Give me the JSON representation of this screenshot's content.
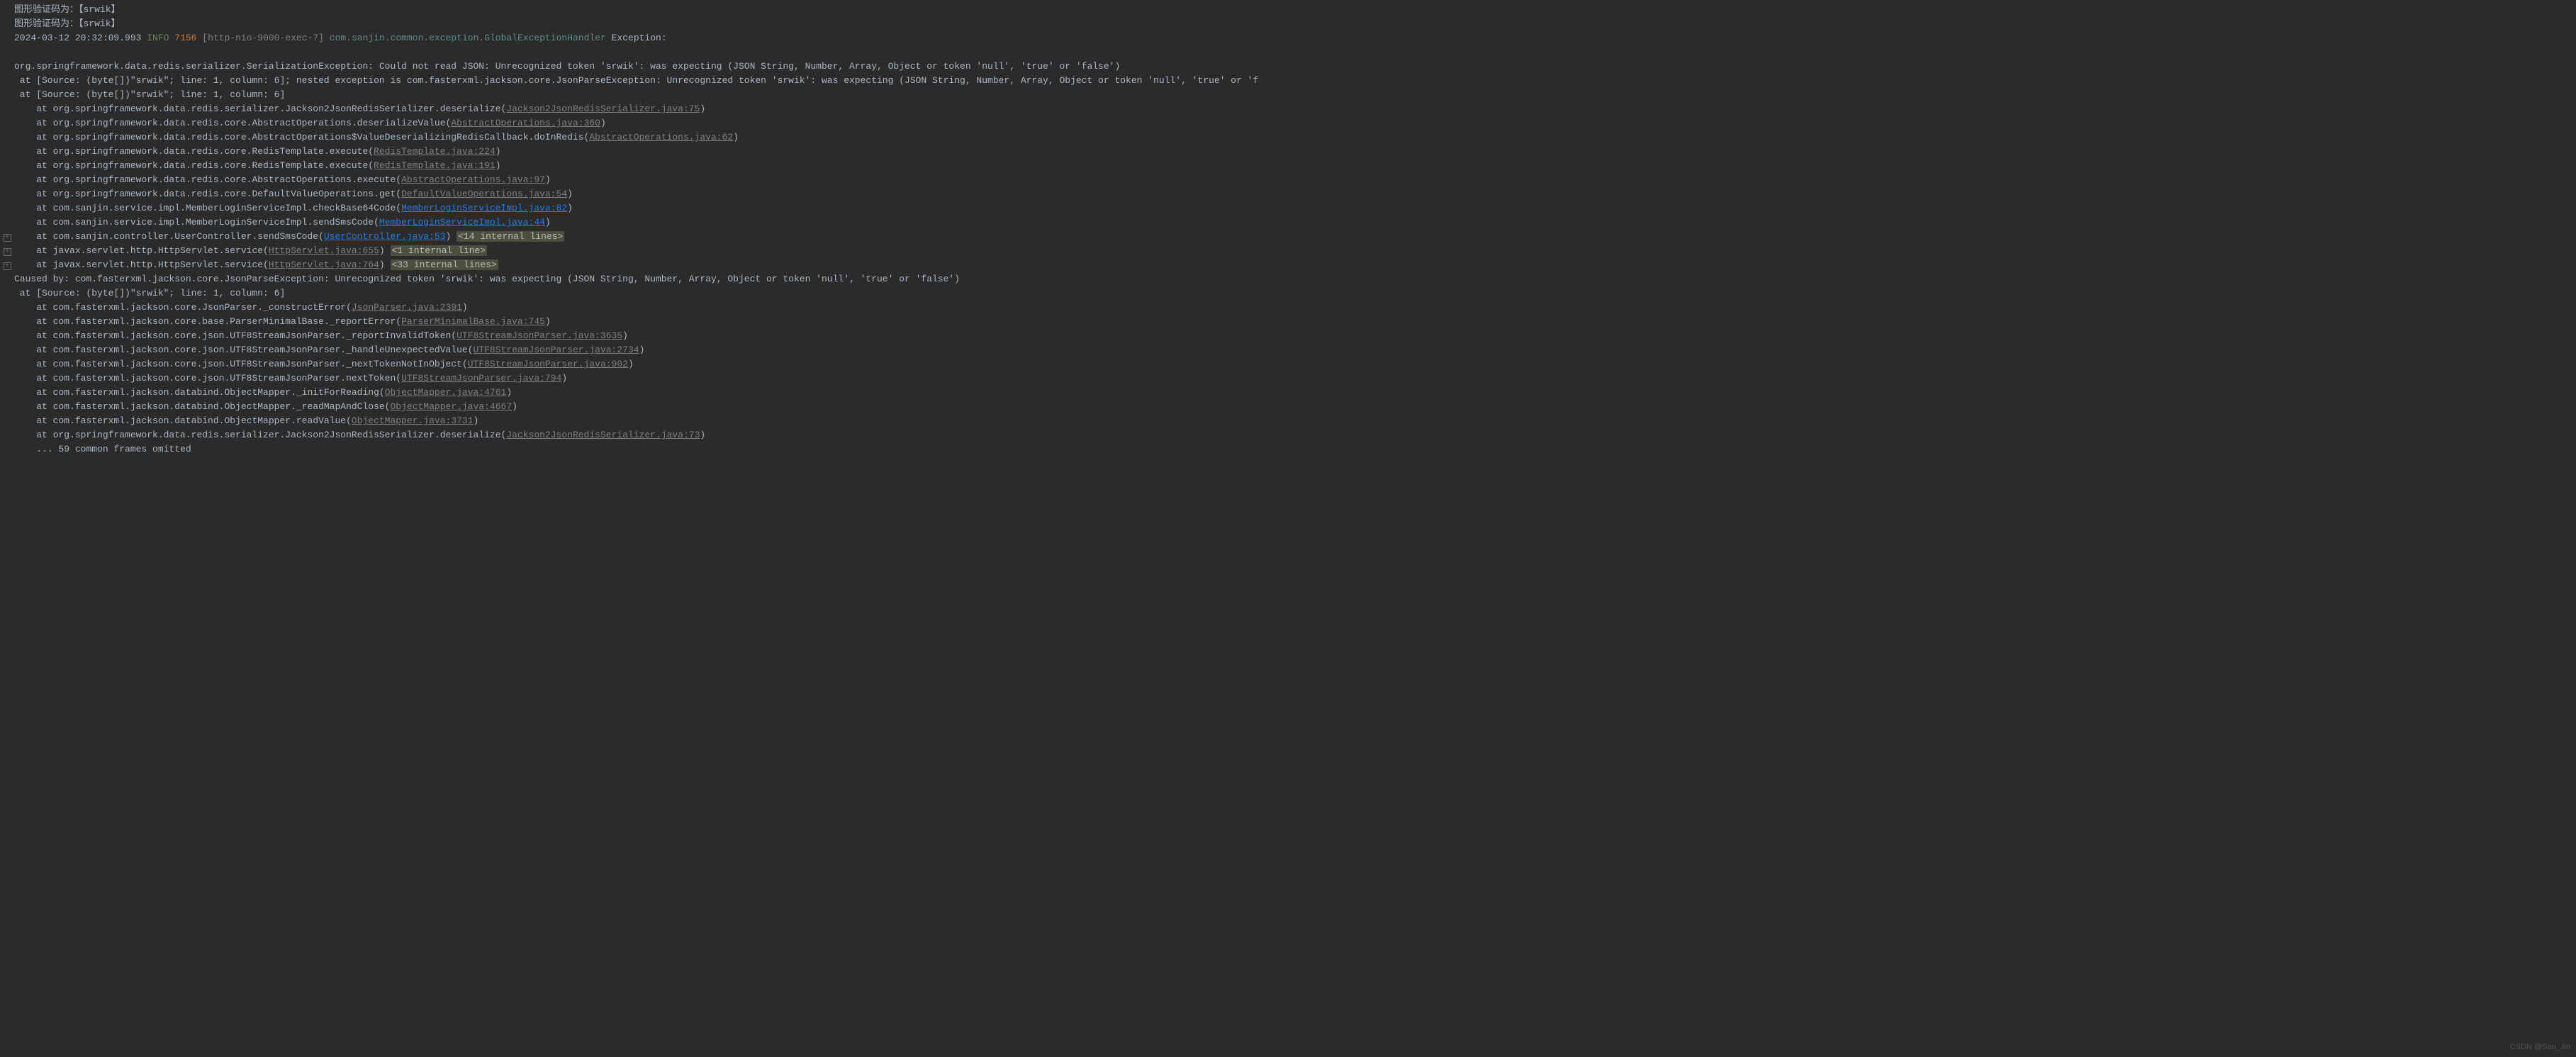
{
  "lines": [
    {
      "gutter": "",
      "segments": [
        {
          "t": "图形验证码为：【srwik】",
          "c": ""
        }
      ]
    },
    {
      "gutter": "",
      "segments": [
        {
          "t": "图形验证码为：【srwik】",
          "c": ""
        }
      ]
    },
    {
      "gutter": "",
      "segments": [
        {
          "t": "2024-03-12 20:32:09.993 ",
          "c": ""
        },
        {
          "t": "INFO",
          "c": "log-info"
        },
        {
          "t": " ",
          "c": ""
        },
        {
          "t": "7156",
          "c": "log-pid"
        },
        {
          "t": " ",
          "c": ""
        },
        {
          "t": "[http-nio-9000-exec-7]",
          "c": "log-thread"
        },
        {
          "t": " ",
          "c": ""
        },
        {
          "t": "com.sanjin.common.exception.GlobalExceptionHandler",
          "c": "log-class"
        },
        {
          "t": " Exception:",
          "c": ""
        }
      ]
    },
    {
      "gutter": "",
      "segments": [
        {
          "t": " ",
          "c": ""
        }
      ]
    },
    {
      "gutter": "",
      "segments": [
        {
          "t": "org.springframework.data.redis.serializer.SerializationException: Could not read JSON: Unrecognized token 'srwik': was expecting (JSON String, Number, Array, Object or token 'null', 'true' or 'false')",
          "c": ""
        }
      ]
    },
    {
      "gutter": "",
      "segments": [
        {
          "t": " at [Source: (byte[])\"srwik\"; line: 1, column: 6]; nested exception is com.fasterxml.jackson.core.JsonParseException: Unrecognized token 'srwik': was expecting (JSON String, Number, Array, Object or token 'null', 'true' or 'f",
          "c": ""
        }
      ]
    },
    {
      "gutter": "",
      "segments": [
        {
          "t": " at [Source: (byte[])\"srwik\"; line: 1, column: 6]",
          "c": ""
        }
      ]
    },
    {
      "gutter": "",
      "segments": [
        {
          "t": "    at org.springframework.data.redis.serializer.Jackson2JsonRedisSerializer.deserialize(",
          "c": ""
        },
        {
          "t": "Jackson2JsonRedisSerializer.java:75",
          "c": "link gray"
        },
        {
          "t": ")",
          "c": ""
        }
      ]
    },
    {
      "gutter": "",
      "segments": [
        {
          "t": "    at org.springframework.data.redis.core.AbstractOperations.deserializeValue(",
          "c": ""
        },
        {
          "t": "AbstractOperations.java:360",
          "c": "link gray"
        },
        {
          "t": ")",
          "c": ""
        }
      ]
    },
    {
      "gutter": "",
      "segments": [
        {
          "t": "    at org.springframework.data.redis.core.AbstractOperations$ValueDeserializingRedisCallback.doInRedis(",
          "c": ""
        },
        {
          "t": "AbstractOperations.java:62",
          "c": "link gray"
        },
        {
          "t": ")",
          "c": ""
        }
      ]
    },
    {
      "gutter": "",
      "segments": [
        {
          "t": "    at org.springframework.data.redis.core.RedisTemplate.execute(",
          "c": ""
        },
        {
          "t": "RedisTemplate.java:224",
          "c": "link gray"
        },
        {
          "t": ")",
          "c": ""
        }
      ]
    },
    {
      "gutter": "",
      "segments": [
        {
          "t": "    at org.springframework.data.redis.core.RedisTemplate.execute(",
          "c": ""
        },
        {
          "t": "RedisTemplate.java:191",
          "c": "link gray"
        },
        {
          "t": ")",
          "c": ""
        }
      ]
    },
    {
      "gutter": "",
      "segments": [
        {
          "t": "    at org.springframework.data.redis.core.AbstractOperations.execute(",
          "c": ""
        },
        {
          "t": "AbstractOperations.java:97",
          "c": "link gray"
        },
        {
          "t": ")",
          "c": ""
        }
      ]
    },
    {
      "gutter": "",
      "segments": [
        {
          "t": "    at org.springframework.data.redis.core.DefaultValueOperations.get(",
          "c": ""
        },
        {
          "t": "DefaultValueOperations.java:54",
          "c": "link gray"
        },
        {
          "t": ")",
          "c": ""
        }
      ]
    },
    {
      "gutter": "",
      "segments": [
        {
          "t": "    at com.sanjin.service.impl.MemberLoginServiceImpl.checkBase64Code(",
          "c": ""
        },
        {
          "t": "MemberLoginServiceImpl.java:82",
          "c": "link"
        },
        {
          "t": ")",
          "c": ""
        }
      ]
    },
    {
      "gutter": "",
      "segments": [
        {
          "t": "    at com.sanjin.service.impl.MemberLoginServiceImpl.sendSmsCode(",
          "c": ""
        },
        {
          "t": "MemberLoginServiceImpl.java:44",
          "c": "link"
        },
        {
          "t": ")",
          "c": ""
        }
      ]
    },
    {
      "gutter": "+",
      "segments": [
        {
          "t": "    at com.sanjin.controller.UserController.sendSmsCode(",
          "c": ""
        },
        {
          "t": "UserController.java:53",
          "c": "link"
        },
        {
          "t": ") ",
          "c": ""
        },
        {
          "t": "<14 internal lines>",
          "c": "hl"
        }
      ]
    },
    {
      "gutter": "+",
      "segments": [
        {
          "t": "    at javax.servlet.http.HttpServlet.service(",
          "c": ""
        },
        {
          "t": "HttpServlet.java:655",
          "c": "link gray"
        },
        {
          "t": ") ",
          "c": ""
        },
        {
          "t": "<1 internal line>",
          "c": "hl"
        }
      ]
    },
    {
      "gutter": "+",
      "segments": [
        {
          "t": "    at javax.servlet.http.HttpServlet.service(",
          "c": ""
        },
        {
          "t": "HttpServlet.java:764",
          "c": "link gray"
        },
        {
          "t": ") ",
          "c": ""
        },
        {
          "t": "<33 internal lines>",
          "c": "hl"
        }
      ]
    },
    {
      "gutter": "",
      "segments": [
        {
          "t": "Caused by: com.fasterxml.jackson.core.JsonParseException: Unrecognized token 'srwik': was expecting (JSON String, Number, Array, Object or token 'null', 'true' or 'false')",
          "c": ""
        }
      ]
    },
    {
      "gutter": "",
      "segments": [
        {
          "t": " at [Source: (byte[])\"srwik\"; line: 1, column: 6]",
          "c": ""
        }
      ]
    },
    {
      "gutter": "",
      "segments": [
        {
          "t": "    at com.fasterxml.jackson.core.JsonParser._constructError(",
          "c": ""
        },
        {
          "t": "JsonParser.java:2391",
          "c": "link gray"
        },
        {
          "t": ")",
          "c": ""
        }
      ]
    },
    {
      "gutter": "",
      "segments": [
        {
          "t": "    at com.fasterxml.jackson.core.base.ParserMinimalBase._reportError(",
          "c": ""
        },
        {
          "t": "ParserMinimalBase.java:745",
          "c": "link gray"
        },
        {
          "t": ")",
          "c": ""
        }
      ]
    },
    {
      "gutter": "",
      "segments": [
        {
          "t": "    at com.fasterxml.jackson.core.json.UTF8StreamJsonParser._reportInvalidToken(",
          "c": ""
        },
        {
          "t": "UTF8StreamJsonParser.java:3635",
          "c": "link gray"
        },
        {
          "t": ")",
          "c": ""
        }
      ]
    },
    {
      "gutter": "",
      "segments": [
        {
          "t": "    at com.fasterxml.jackson.core.json.UTF8StreamJsonParser._handleUnexpectedValue(",
          "c": ""
        },
        {
          "t": "UTF8StreamJsonParser.java:2734",
          "c": "link gray"
        },
        {
          "t": ")",
          "c": ""
        }
      ]
    },
    {
      "gutter": "",
      "segments": [
        {
          "t": "    at com.fasterxml.jackson.core.json.UTF8StreamJsonParser._nextTokenNotInObject(",
          "c": ""
        },
        {
          "t": "UTF8StreamJsonParser.java:902",
          "c": "link gray"
        },
        {
          "t": ")",
          "c": ""
        }
      ]
    },
    {
      "gutter": "",
      "segments": [
        {
          "t": "    at com.fasterxml.jackson.core.json.UTF8StreamJsonParser.nextToken(",
          "c": ""
        },
        {
          "t": "UTF8StreamJsonParser.java:794",
          "c": "link gray"
        },
        {
          "t": ")",
          "c": ""
        }
      ]
    },
    {
      "gutter": "",
      "segments": [
        {
          "t": "    at com.fasterxml.jackson.databind.ObjectMapper._initForReading(",
          "c": ""
        },
        {
          "t": "ObjectMapper.java:4761",
          "c": "link gray"
        },
        {
          "t": ")",
          "c": ""
        }
      ]
    },
    {
      "gutter": "",
      "segments": [
        {
          "t": "    at com.fasterxml.jackson.databind.ObjectMapper._readMapAndClose(",
          "c": ""
        },
        {
          "t": "ObjectMapper.java:4667",
          "c": "link gray"
        },
        {
          "t": ")",
          "c": ""
        }
      ]
    },
    {
      "gutter": "",
      "segments": [
        {
          "t": "    at com.fasterxml.jackson.databind.ObjectMapper.readValue(",
          "c": ""
        },
        {
          "t": "ObjectMapper.java:3731",
          "c": "link gray"
        },
        {
          "t": ")",
          "c": ""
        }
      ]
    },
    {
      "gutter": "",
      "segments": [
        {
          "t": "    at org.springframework.data.redis.serializer.Jackson2JsonRedisSerializer.deserialize(",
          "c": ""
        },
        {
          "t": "Jackson2JsonRedisSerializer.java:73",
          "c": "link gray"
        },
        {
          "t": ")",
          "c": ""
        }
      ]
    },
    {
      "gutter": "",
      "segments": [
        {
          "t": "    ... 59 common frames omitted",
          "c": ""
        }
      ]
    }
  ],
  "watermark": "CSDN @San_Jin"
}
